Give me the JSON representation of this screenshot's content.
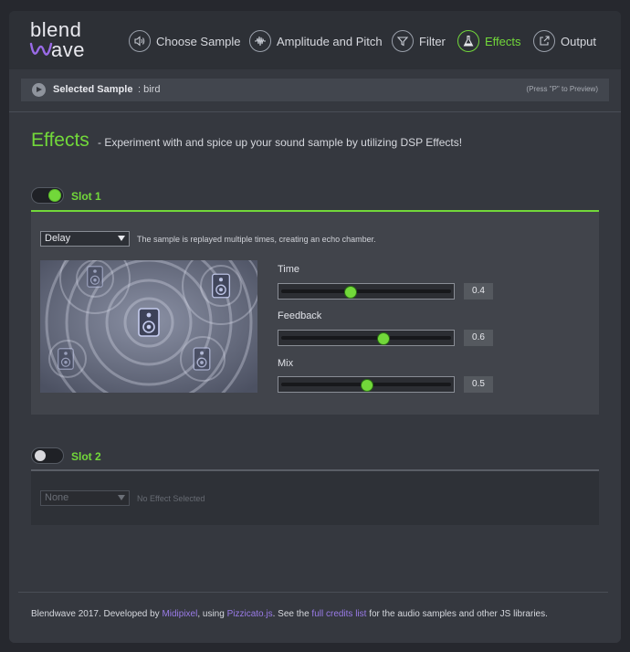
{
  "brand": {
    "line1": "blend",
    "line2": "ave"
  },
  "nav": [
    {
      "label": "Choose Sample",
      "icon": "speaker-icon"
    },
    {
      "label": "Amplitude and Pitch",
      "icon": "waveform-icon"
    },
    {
      "label": "Filter",
      "icon": "funnel-icon"
    },
    {
      "label": "Effects",
      "icon": "flask-icon",
      "active": true
    },
    {
      "label": "Output",
      "icon": "export-icon"
    }
  ],
  "selected": {
    "label": "Selected Sample",
    "sep": " : ",
    "value": "bird",
    "hint": "(Press \"P\" to Preview)"
  },
  "page": {
    "title": "Effects",
    "subtitle": "- Experiment with and spice up your sound sample by utilizing DSP Effects!"
  },
  "slot1": {
    "label": "Slot 1",
    "enabled": true,
    "effect": "Delay",
    "description": "The sample is replayed multiple times, creating an echo chamber.",
    "params": [
      {
        "name": "Time",
        "value": "0.4",
        "fraction": 0.4
      },
      {
        "name": "Feedback",
        "value": "0.6",
        "fraction": 0.6
      },
      {
        "name": "Mix",
        "value": "0.5",
        "fraction": 0.5
      }
    ]
  },
  "slot2": {
    "label": "Slot 2",
    "enabled": false,
    "effect": "None",
    "description": "No Effect Selected"
  },
  "footer": {
    "prefix": "Blendwave 2017. Developed by ",
    "developer": "Midipixel",
    "mid1": ", using ",
    "library": "Pizzicato.js",
    "mid2": ". See the ",
    "credits": "full credits list",
    "suffix": " for the audio samples and other JS libraries."
  },
  "colors": {
    "accent": "#72d83a",
    "link": "#9a7be8",
    "background": "#35383f",
    "panel": "#41444b"
  }
}
